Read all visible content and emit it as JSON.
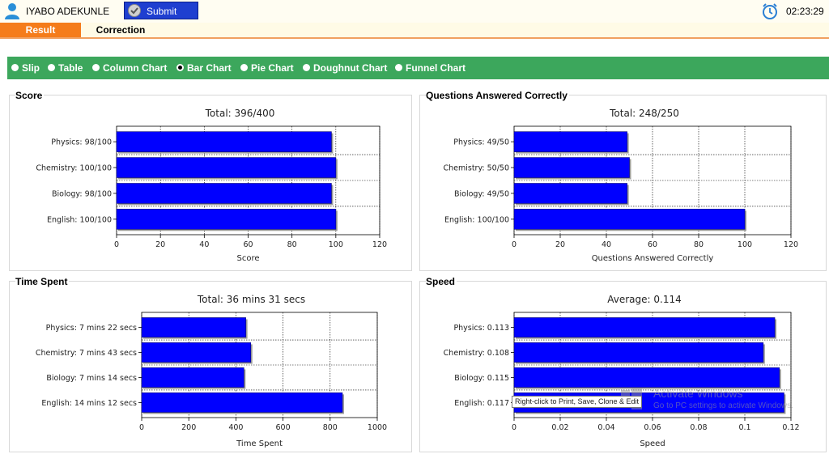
{
  "header": {
    "user_name": "IYABO ADEKUNLE",
    "submit_label": "Submit",
    "timer": "02:23:29"
  },
  "tabs": [
    {
      "label": "Result",
      "active": true
    },
    {
      "label": "Correction",
      "active": false
    }
  ],
  "chart_options": [
    {
      "label": "Slip",
      "selected": false
    },
    {
      "label": "Table",
      "selected": false
    },
    {
      "label": "Column Chart",
      "selected": false
    },
    {
      "label": "Bar Chart",
      "selected": true
    },
    {
      "label": "Pie Chart",
      "selected": false
    },
    {
      "label": "Doughnut Chart",
      "selected": false
    },
    {
      "label": "Funnel Chart",
      "selected": false
    }
  ],
  "colors": {
    "accent_orange": "#f57c1a",
    "green_bar": "#3ca75c",
    "bar_fill": "#0000ff",
    "submit_blue": "#1f3fd0"
  },
  "chart_data": [
    {
      "type": "bar",
      "panel_title": "Score",
      "title": "Total: 396/400",
      "categories": [
        "Physics: 98/100",
        "Chemistry: 100/100",
        "Biology: 98/100",
        "English: 100/100"
      ],
      "values": [
        98,
        100,
        98,
        100
      ],
      "xlabel": "Score",
      "xlim": [
        0,
        120
      ],
      "ticks": [
        "0",
        "20",
        "40",
        "60",
        "80",
        "100",
        "120"
      ],
      "grid": true
    },
    {
      "type": "bar",
      "panel_title": "Questions Answered Correctly",
      "title": "Total: 248/250",
      "categories": [
        "Physics: 49/50",
        "Chemistry: 50/50",
        "Biology: 49/50",
        "English: 100/100"
      ],
      "values": [
        49,
        50,
        49,
        100
      ],
      "xlabel": "Questions Answered Correctly",
      "xlim": [
        0,
        120
      ],
      "ticks": [
        "0",
        "20",
        "40",
        "60",
        "80",
        "100",
        "120"
      ],
      "grid": true
    },
    {
      "type": "bar",
      "panel_title": "Time Spent",
      "title": "Total: 36 mins 31 secs",
      "categories": [
        "Physics: 7 mins 22 secs",
        "Chemistry: 7 mins 43 secs",
        "Biology: 7 mins 14 secs",
        "English: 14 mins 12 secs"
      ],
      "values": [
        442,
        463,
        434,
        852
      ],
      "xlabel": "Time Spent",
      "xlim": [
        0,
        1000
      ],
      "ticks": [
        "0",
        "200",
        "400",
        "600",
        "800",
        "1000"
      ],
      "grid": true
    },
    {
      "type": "bar",
      "panel_title": "Speed",
      "title": "Average: 0.114",
      "categories": [
        "Physics: 0.113",
        "Chemistry: 0.108",
        "Biology: 0.115",
        "English: 0.117"
      ],
      "values": [
        0.113,
        0.108,
        0.115,
        0.117
      ],
      "xlabel": "Speed",
      "xlim": [
        0,
        0.12
      ],
      "ticks": [
        "0",
        "0.02",
        "0.04",
        "0.06",
        "0.08",
        "0.1",
        "0.12"
      ],
      "grid": true
    }
  ],
  "tooltip": "Right-click to Print, Save, Clone & Edit",
  "watermark": {
    "line1": "Activate Windows",
    "line2": "Go to PC settings to activate Windows."
  }
}
